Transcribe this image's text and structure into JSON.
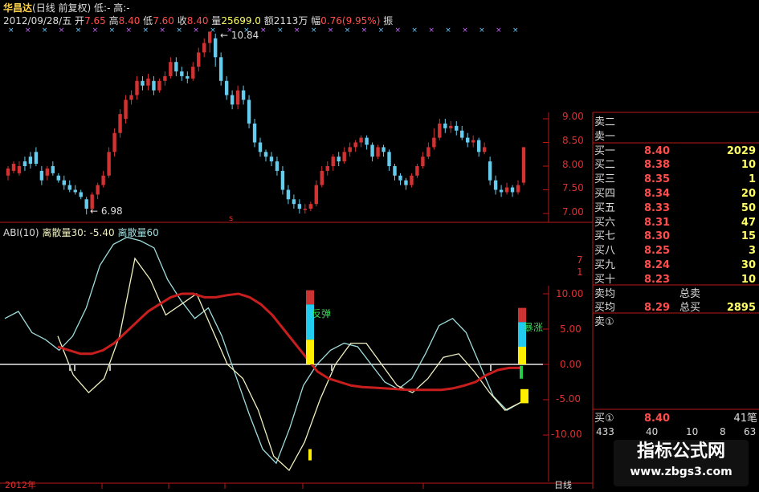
{
  "header": {
    "stock": "华昌达",
    "mode": "(日线 前复权)",
    "low_label": "低:",
    "low_val": "-",
    "high_label": "高:",
    "high_val": "-",
    "date": "2012/09/28/五",
    "open_label": "开",
    "open": "7.65",
    "high2_label": "高",
    "high2": "8.40",
    "low2_label": "低",
    "low2": "7.60",
    "close_label": "收",
    "close": "8.40",
    "vol_label": "量",
    "vol": "25699.0",
    "amt_label": "额",
    "amt": "2113万",
    "chg_label": "幅",
    "chg": "0.76(9.95%)",
    "extra": "振"
  },
  "indicator": {
    "name": "ABI(10)",
    "line1": "离散量30: -5.40",
    "line2": "离散量60",
    "signal1": "反弹",
    "signal2": "暴涨"
  },
  "annotations": {
    "high": "10.84",
    "low": "6.98",
    "tiny_s": "s"
  },
  "price_axis": [
    "9.00",
    "8.50",
    "8.00",
    "7.50",
    "7.00"
  ],
  "ind_axis": [
    "10.00",
    "5.00",
    "0.00",
    "-5.00",
    "-10.00"
  ],
  "side_ticks": [
    "7",
    "1"
  ],
  "bottom": {
    "left_date": "2012年",
    "right_label": "日线"
  },
  "order_book": {
    "sell": [
      {
        "label": "卖二"
      },
      {
        "label": "卖一"
      }
    ],
    "buy": [
      {
        "label": "买一",
        "price": "8.40",
        "vol": "2029"
      },
      {
        "label": "买二",
        "price": "8.38",
        "vol": "10"
      },
      {
        "label": "买三",
        "price": "8.35",
        "vol": "1"
      },
      {
        "label": "买四",
        "price": "8.34",
        "vol": "20"
      },
      {
        "label": "买五",
        "price": "8.33",
        "vol": "50"
      },
      {
        "label": "买六",
        "price": "8.31",
        "vol": "47"
      },
      {
        "label": "买七",
        "price": "8.30",
        "vol": "15"
      },
      {
        "label": "买八",
        "price": "8.25",
        "vol": "3"
      },
      {
        "label": "买九",
        "price": "8.24",
        "vol": "30"
      },
      {
        "label": "买十",
        "price": "8.23",
        "vol": "10"
      }
    ],
    "avg_sell_label": "卖均",
    "total_sell_label": "总卖",
    "avg_buy_label": "买均",
    "avg_buy": "8.29",
    "total_buy_label": "总买",
    "total_buy": "2895",
    "sell1_label": "卖①",
    "buy1_label": "买①",
    "buy1_price": "8.40",
    "buy1_count": "41笔",
    "queue": [
      "433",
      "40",
      "10",
      "8",
      "63"
    ]
  },
  "watermark": {
    "line1": "指标公式网",
    "line2": "www.zbgs3.com"
  },
  "colors": {
    "up": "#d23232",
    "down": "#66ccee",
    "accent": "#ff4d4d",
    "ma": "#c81e1e"
  },
  "chart_data": {
    "type": "line",
    "candles": [
      [
        7.8,
        7.95,
        7.7,
        8.0
      ],
      [
        7.9,
        8.05,
        7.85,
        8.1
      ],
      [
        7.85,
        8.0,
        7.8,
        8.1
      ],
      [
        8.1,
        8.0,
        7.9,
        8.2
      ],
      [
        8.2,
        8.05,
        7.95,
        8.3
      ],
      [
        8.3,
        8.05,
        8.0,
        8.4
      ],
      [
        7.9,
        7.7,
        7.6,
        8.0
      ],
      [
        7.8,
        7.95,
        7.7,
        8.0
      ],
      [
        8.0,
        7.85,
        7.8,
        8.1
      ],
      [
        7.8,
        7.7,
        7.65,
        7.85
      ],
      [
        7.7,
        7.6,
        7.5,
        7.8
      ],
      [
        7.6,
        7.5,
        7.45,
        7.7
      ],
      [
        7.5,
        7.45,
        7.4,
        7.6
      ],
      [
        7.45,
        7.35,
        7.3,
        7.5
      ],
      [
        7.3,
        7.1,
        6.98,
        7.35
      ],
      [
        7.1,
        7.4,
        7.0,
        7.45
      ],
      [
        7.4,
        7.6,
        7.3,
        7.65
      ],
      [
        7.6,
        7.8,
        7.55,
        7.9
      ],
      [
        7.8,
        8.3,
        7.75,
        8.4
      ],
      [
        8.3,
        8.7,
        8.2,
        8.8
      ],
      [
        8.7,
        9.1,
        8.6,
        9.2
      ],
      [
        9.0,
        9.4,
        8.9,
        9.5
      ],
      [
        9.4,
        9.5,
        9.3,
        9.6
      ],
      [
        9.5,
        9.8,
        9.4,
        9.9
      ],
      [
        9.8,
        9.7,
        9.6,
        9.9
      ],
      [
        9.7,
        9.85,
        9.6,
        9.95
      ],
      [
        9.8,
        9.6,
        9.5,
        9.9
      ],
      [
        9.6,
        9.8,
        9.55,
        9.85
      ],
      [
        9.8,
        9.9,
        9.7,
        10.0
      ],
      [
        9.9,
        10.2,
        9.85,
        10.3
      ],
      [
        10.2,
        10.0,
        9.9,
        10.3
      ],
      [
        10.0,
        9.9,
        9.8,
        10.1
      ],
      [
        9.9,
        9.85,
        9.75,
        10.0
      ],
      [
        9.85,
        10.1,
        9.8,
        10.2
      ],
      [
        10.1,
        10.4,
        10.0,
        10.5
      ],
      [
        10.4,
        10.6,
        10.3,
        10.7
      ],
      [
        10.6,
        10.84,
        10.4,
        10.84
      ],
      [
        10.7,
        10.3,
        10.1,
        10.8
      ],
      [
        10.3,
        9.8,
        9.7,
        10.4
      ],
      [
        9.8,
        9.5,
        9.4,
        9.9
      ],
      [
        9.5,
        9.3,
        9.2,
        9.6
      ],
      [
        9.3,
        9.6,
        9.2,
        9.7
      ],
      [
        9.6,
        9.4,
        9.3,
        9.7
      ],
      [
        9.4,
        8.9,
        8.8,
        9.5
      ],
      [
        8.9,
        8.5,
        8.4,
        9.0
      ],
      [
        8.5,
        8.3,
        8.2,
        8.6
      ],
      [
        8.3,
        8.2,
        8.1,
        8.35
      ],
      [
        8.2,
        8.1,
        8.0,
        8.3
      ],
      [
        8.1,
        7.9,
        7.8,
        8.2
      ],
      [
        7.9,
        7.5,
        7.4,
        8.0
      ],
      [
        7.5,
        7.3,
        7.2,
        7.6
      ],
      [
        7.3,
        7.2,
        7.1,
        7.4
      ],
      [
        7.2,
        7.1,
        7.0,
        7.3
      ],
      [
        7.1,
        7.1,
        7.0,
        7.2
      ],
      [
        7.1,
        7.2,
        7.05,
        7.25
      ],
      [
        7.2,
        7.6,
        7.15,
        7.7
      ],
      [
        7.6,
        7.9,
        7.55,
        8.0
      ],
      [
        7.9,
        8.0,
        7.8,
        8.1
      ],
      [
        8.0,
        8.2,
        7.9,
        8.25
      ],
      [
        8.2,
        8.1,
        8.0,
        8.3
      ],
      [
        8.1,
        8.3,
        8.05,
        8.4
      ],
      [
        8.3,
        8.4,
        8.2,
        8.5
      ],
      [
        8.4,
        8.5,
        8.3,
        8.55
      ],
      [
        8.5,
        8.6,
        8.4,
        8.65
      ],
      [
        8.6,
        8.45,
        8.35,
        8.65
      ],
      [
        8.45,
        8.2,
        8.1,
        8.5
      ],
      [
        8.2,
        8.4,
        8.15,
        8.45
      ],
      [
        8.4,
        8.3,
        8.2,
        8.45
      ],
      [
        8.3,
        8.0,
        7.9,
        8.35
      ],
      [
        8.0,
        7.8,
        7.7,
        8.05
      ],
      [
        7.8,
        7.7,
        7.6,
        7.85
      ],
      [
        7.7,
        7.6,
        7.5,
        7.75
      ],
      [
        7.6,
        7.8,
        7.55,
        7.85
      ],
      [
        7.8,
        8.0,
        7.75,
        8.05
      ],
      [
        8.0,
        8.2,
        7.95,
        8.3
      ],
      [
        8.2,
        8.4,
        8.15,
        8.5
      ],
      [
        8.4,
        8.6,
        8.35,
        8.8
      ],
      [
        8.6,
        8.9,
        8.55,
        9.0
      ],
      [
        8.9,
        8.8,
        8.7,
        9.0
      ],
      [
        8.8,
        8.85,
        8.7,
        8.95
      ],
      [
        8.85,
        8.75,
        8.65,
        8.95
      ],
      [
        8.75,
        8.6,
        8.55,
        8.85
      ],
      [
        8.6,
        8.5,
        8.4,
        8.7
      ],
      [
        8.5,
        8.55,
        8.4,
        8.65
      ],
      [
        8.55,
        8.3,
        8.2,
        8.6
      ],
      [
        8.3,
        8.4,
        8.25,
        8.5
      ],
      [
        8.1,
        7.7,
        7.6,
        8.2
      ],
      [
        7.7,
        7.5,
        7.4,
        7.8
      ],
      [
        7.5,
        7.45,
        7.35,
        7.6
      ],
      [
        7.45,
        7.55,
        7.4,
        7.65
      ],
      [
        7.55,
        7.45,
        7.35,
        7.6
      ],
      [
        7.45,
        7.6,
        7.4,
        7.7
      ],
      [
        7.65,
        8.4,
        7.6,
        8.4
      ]
    ],
    "ma_values": [
      2.5,
      2.0,
      1.5,
      1.5,
      2.0,
      3.0,
      4.5,
      6.0,
      7.5,
      8.5,
      9.5,
      10.0,
      10.0,
      9.5,
      9.5,
      9.8,
      10.0,
      9.5,
      8.5,
      7.0,
      5.0,
      3.0,
      1.0,
      -1.0,
      -2.0,
      -2.5,
      -3.0,
      -3.2,
      -3.3,
      -3.4,
      -3.5,
      -3.6,
      -3.6,
      -3.6,
      -3.6,
      -3.4,
      -3.0,
      -2.5,
      -1.5,
      -0.8,
      -0.5,
      -0.5
    ],
    "line30_values": [
      4,
      -1.5,
      -4,
      -2,
      4,
      15,
      12,
      7,
      8.5,
      10,
      5,
      0,
      -2,
      -6.5,
      -13,
      -15,
      -11,
      -5,
      0,
      3,
      3,
      0,
      -3,
      -4,
      -2,
      1,
      1.5,
      -1,
      -4,
      -6.5,
      -5.4
    ],
    "line60_values": [
      6.5,
      7.5,
      4.5,
      3.5,
      2,
      4,
      8,
      14,
      17,
      18,
      17.5,
      16.5,
      12,
      9,
      6.5,
      8,
      4,
      -1.5,
      -7,
      -12,
      -14,
      -9,
      -3,
      0,
      2,
      3,
      2.5,
      0,
      -2.5,
      -3.5,
      -2,
      1.5,
      5.5,
      6.5,
      4.5,
      0,
      -4.5,
      -6.5,
      -5.4
    ],
    "ylim_price": [
      6.8,
      11.0
    ],
    "ylim_ind": [
      -15,
      18
    ]
  }
}
